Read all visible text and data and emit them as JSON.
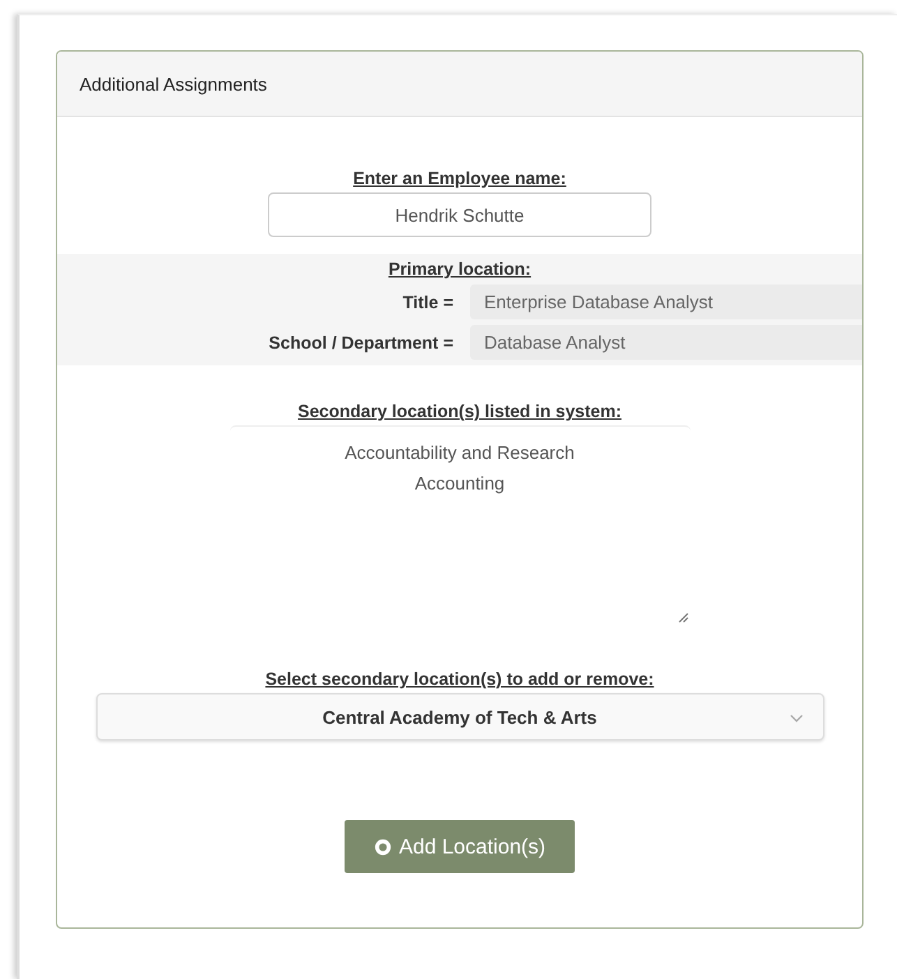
{
  "card": {
    "title": "Additional Assignments"
  },
  "employee": {
    "label": "Enter an Employee name:",
    "value": "Hendrik Schutte"
  },
  "primary": {
    "label": "Primary location:",
    "fields": [
      {
        "label": "Title =",
        "value": "Enterprise Database Analyst"
      },
      {
        "label": "School / Department =",
        "value": "Database Analyst"
      }
    ]
  },
  "secondary": {
    "label": "Secondary location(s) listed in system:",
    "items": [
      "Accountability and Research",
      "Accounting"
    ]
  },
  "select": {
    "label": "Select secondary location(s) to add or remove:",
    "value": "Central Academy of Tech & Arts"
  },
  "button": {
    "label": "Add Location(s)"
  }
}
